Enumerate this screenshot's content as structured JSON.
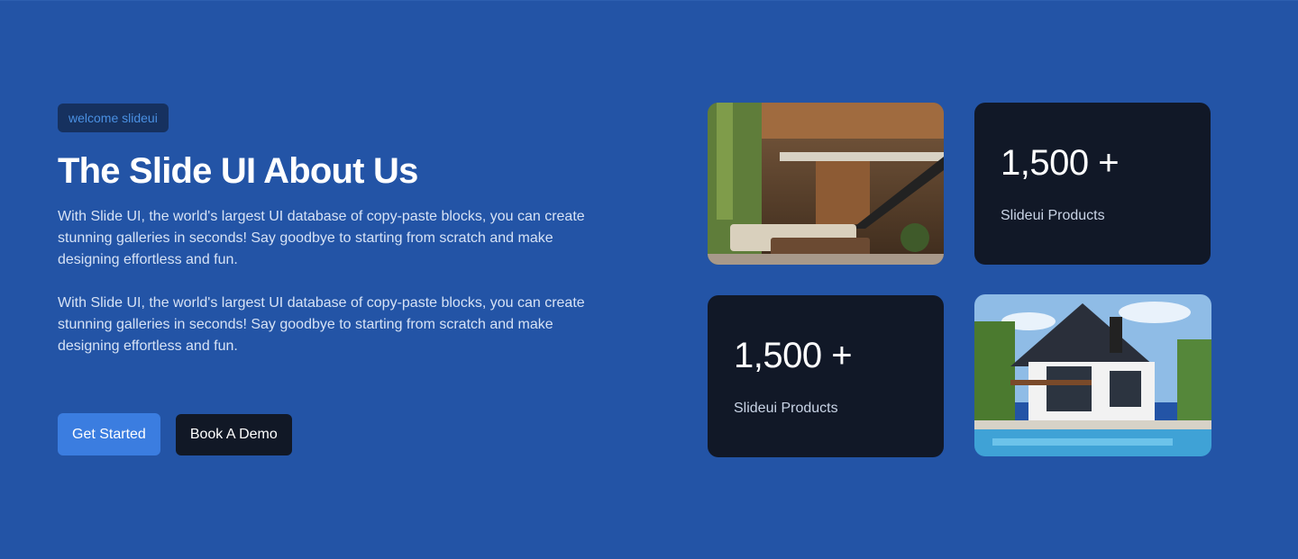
{
  "hero": {
    "badge": "welcome slideui",
    "title": "The Slide UI About Us",
    "paragraphs": [
      "With Slide UI, the world's largest UI database of copy-paste blocks, you can create stunning galleries in seconds! Say goodbye to starting from scratch and make designing effortless and fun.",
      "With Slide UI, the world's largest UI database of copy-paste blocks, you can create stunning galleries in seconds! Say goodbye to starting from scratch and make designing effortless and fun."
    ],
    "primary_button": "Get Started",
    "secondary_button": "Book A Demo"
  },
  "stats": [
    {
      "value": "1,500 +",
      "label": "Slideui Products"
    },
    {
      "value": "1,500 +",
      "label": "Slideui Products"
    }
  ],
  "images": [
    {
      "name": "interior-living-room-photo"
    },
    {
      "name": "modern-house-pool-photo"
    }
  ],
  "colors": {
    "background": "#2354a6",
    "badge_bg": "#16315f",
    "badge_text": "#4a90e2",
    "primary_button": "#3b7de0",
    "dark_card": "#111827"
  }
}
